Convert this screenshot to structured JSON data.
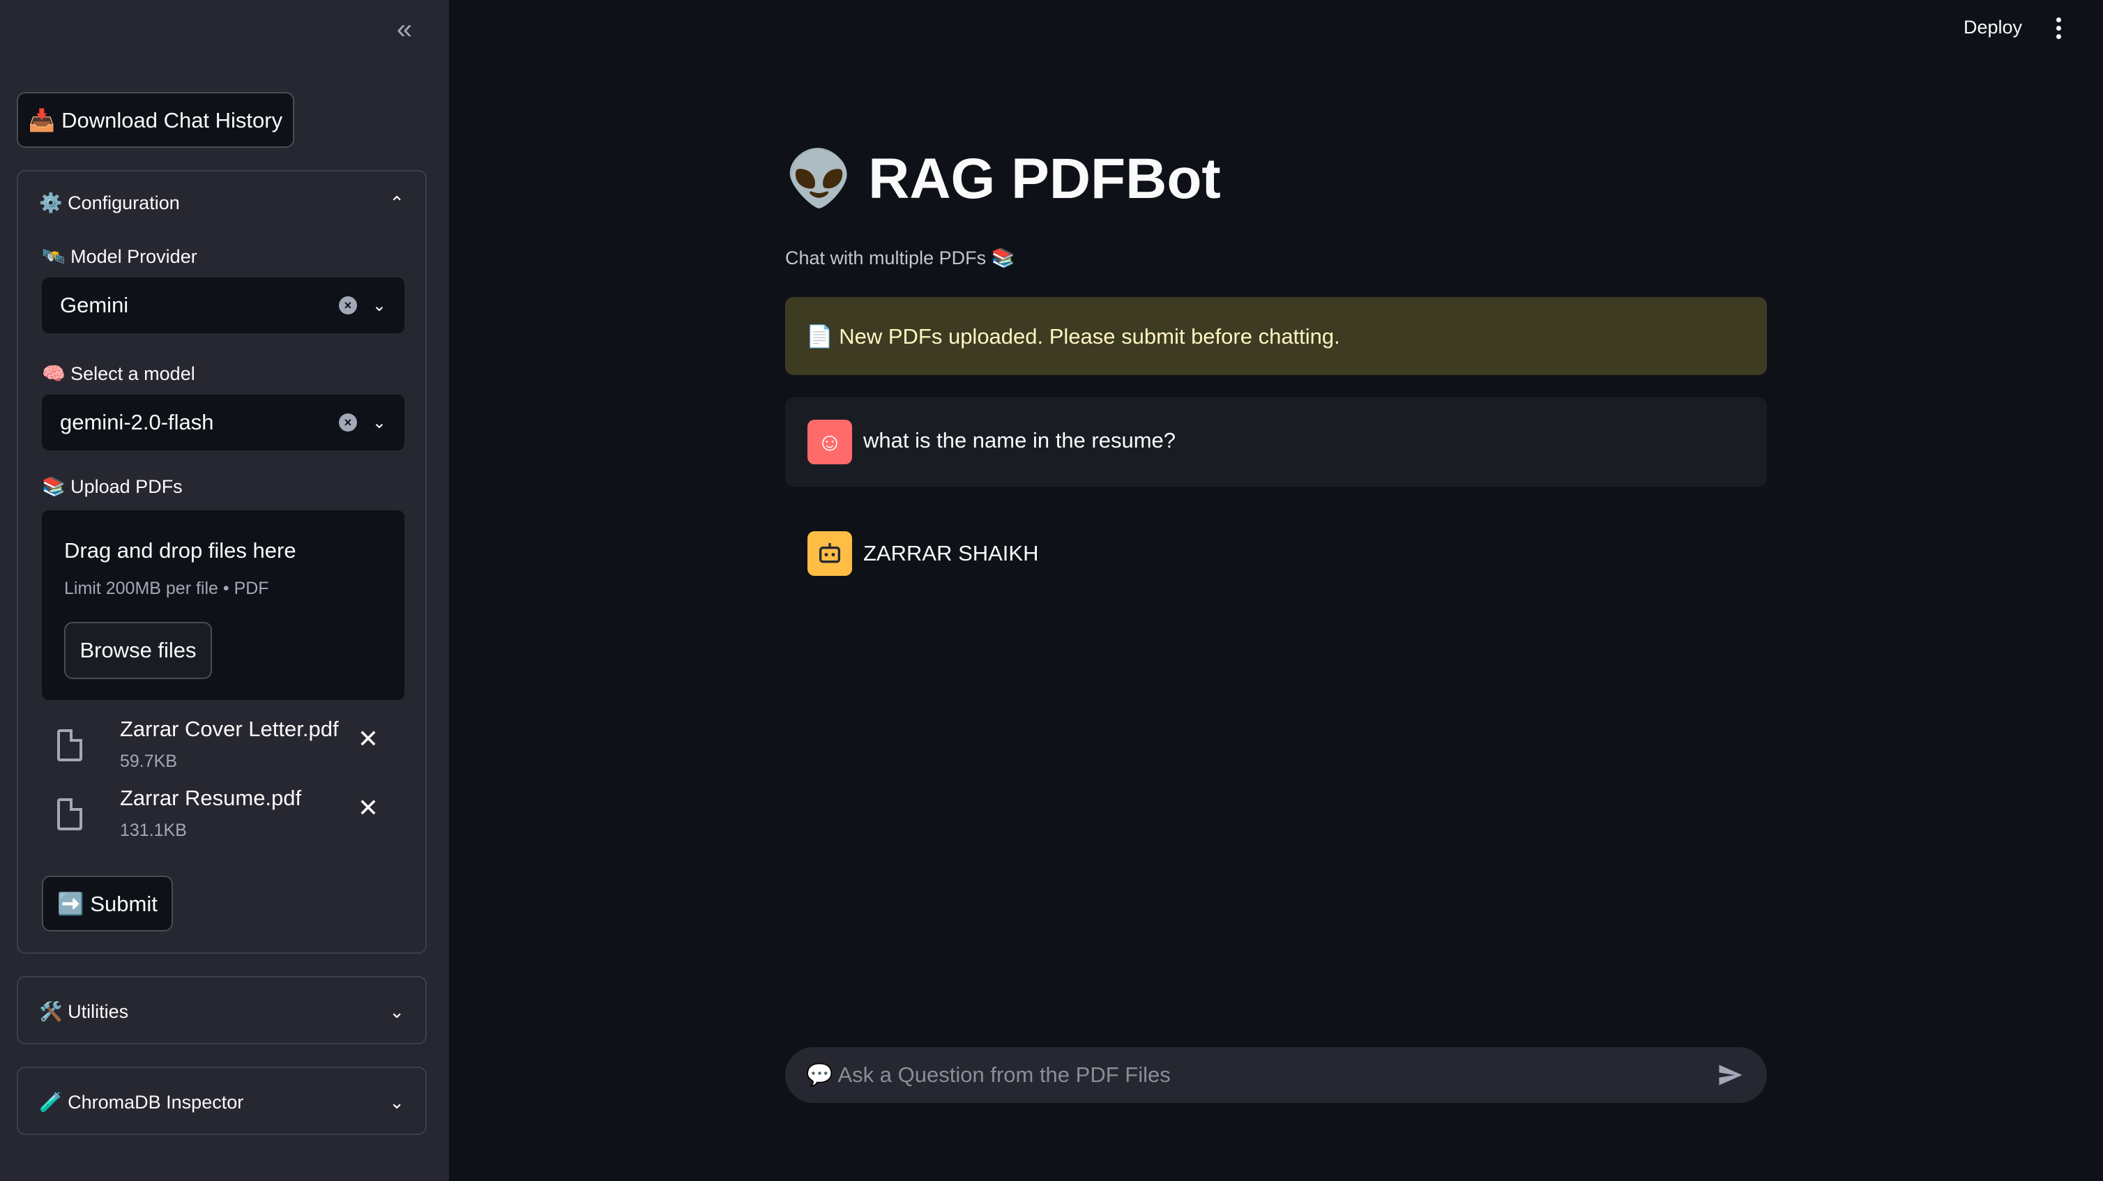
{
  "sidebar": {
    "download_label": "📥 Download Chat History",
    "configuration": {
      "title": "⚙️ Configuration",
      "model_provider_label": "🛰️ Model Provider",
      "model_provider_value": "Gemini",
      "model_label": "🧠 Select a model",
      "model_value": "gemini-2.0-flash",
      "upload_label": "📚 Upload PDFs",
      "dropzone_title": "Drag and drop files here",
      "dropzone_limit": "Limit 200MB per file • PDF",
      "browse_label": "Browse files",
      "files": [
        {
          "name": "Zarrar Cover Letter.pdf",
          "size": "59.7KB"
        },
        {
          "name": "Zarrar Resume.pdf",
          "size": "131.1KB"
        }
      ],
      "submit_label": "➡️ Submit"
    },
    "utilities_title": "🛠️ Utilities",
    "chromadb_title": "🧪 ChromaDB Inspector"
  },
  "topbar": {
    "deploy_label": "Deploy"
  },
  "main": {
    "title": "RAG PDFBot",
    "title_icon": "👽",
    "subtitle": "Chat with multiple PDFs 📚",
    "warning": "📄 New PDFs uploaded. Please submit before chatting.",
    "messages": [
      {
        "role": "user",
        "text": "what is the name in the resume?"
      },
      {
        "role": "assistant",
        "text": "ZARRAR SHAIKH"
      }
    ],
    "chat_placeholder": "💬 Ask a Question from the PDF Files"
  },
  "colors": {
    "background": "#0e1117",
    "sidebar": "#262730",
    "warning_bg": "#3e3b23",
    "user_avatar": "#ff6b6b",
    "bot_avatar": "#ffbd45"
  }
}
